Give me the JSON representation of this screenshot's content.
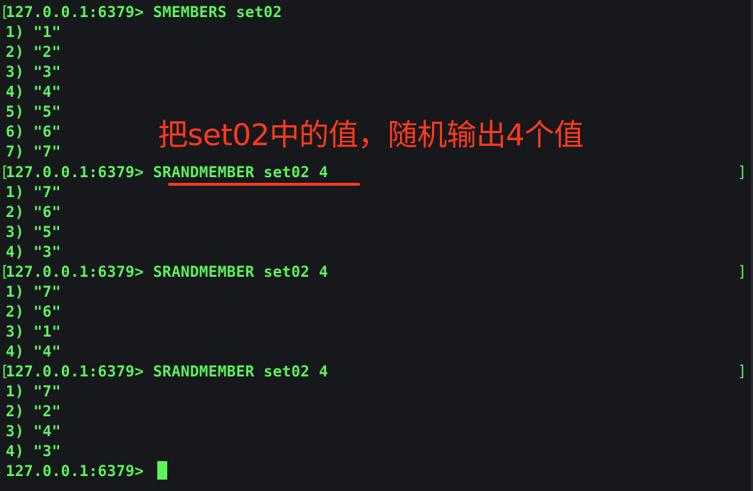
{
  "terminal": {
    "prompt": "127.0.0.1:6379> ",
    "blocks": [
      {
        "command": "SMEMBERS set02",
        "results": [
          "1) \"1\"",
          "2) \"2\"",
          "3) \"3\"",
          "4) \"4\"",
          "5) \"5\"",
          "6) \"6\"",
          "7) \"7\""
        ]
      },
      {
        "command": "SRANDMEMBER set02 4",
        "results": [
          "1) \"7\"",
          "2) \"6\"",
          "3) \"5\"",
          "4) \"3\""
        ]
      },
      {
        "command": "SRANDMEMBER set02 4",
        "results": [
          "1) \"7\"",
          "2) \"6\"",
          "3) \"1\"",
          "4) \"4\""
        ]
      },
      {
        "command": "SRANDMEMBER set02 4",
        "results": [
          "1) \"7\"",
          "2) \"2\"",
          "3) \"4\"",
          "4) \"3\""
        ]
      }
    ],
    "final_prompt": "127.0.0.1:6379> "
  },
  "annotation": {
    "text": "把set02中的值，随机输出4个值",
    "color": "#ff3a1e"
  },
  "colors": {
    "background": "#16181b",
    "text": "#5cf25c"
  }
}
